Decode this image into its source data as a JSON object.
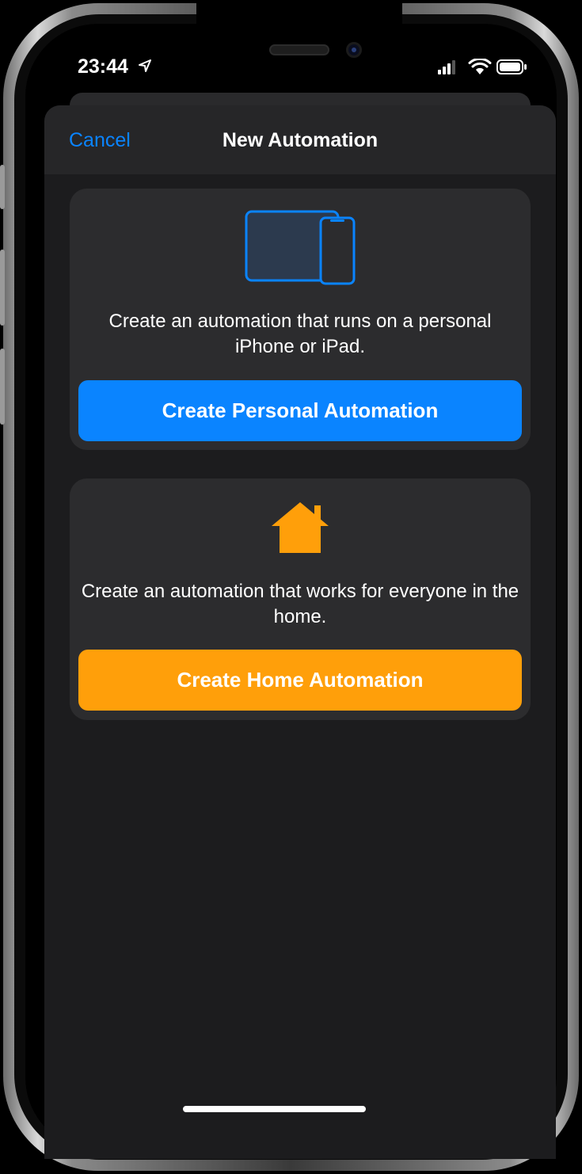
{
  "status_bar": {
    "time": "23:44",
    "location_icon": "location-arrow-icon",
    "signal_icon": "cellular-signal-icon",
    "wifi_icon": "wifi-icon",
    "battery_icon": "battery-icon"
  },
  "nav": {
    "cancel_label": "Cancel",
    "title": "New Automation"
  },
  "personal_card": {
    "icon": "iphone-ipad-devices-icon",
    "description": "Create an automation that runs on a personal iPhone or iPad.",
    "button_label": "Create Personal Automation",
    "button_color": "#0a84ff"
  },
  "home_card": {
    "icon": "house-icon",
    "description": "Create an automation that works for everyone in the home.",
    "button_label": "Create Home Automation",
    "button_color": "#ff9f0a"
  },
  "colors": {
    "accent_blue": "#0a84ff",
    "accent_orange": "#ff9f0a",
    "sheet_background": "#1c1c1e",
    "card_background": "#2c2c2e"
  }
}
